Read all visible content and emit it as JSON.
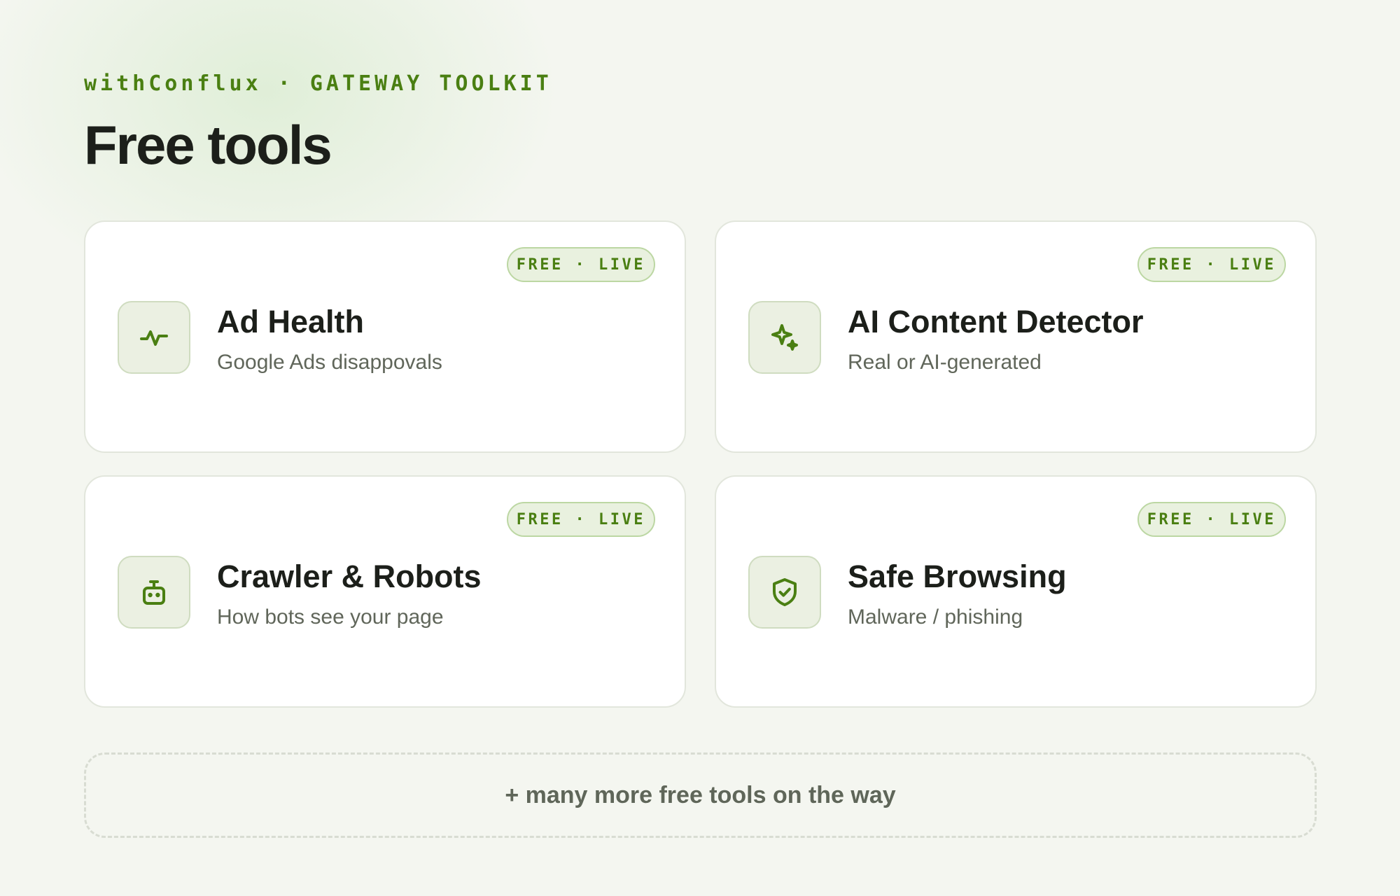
{
  "header": {
    "eyebrow": "withConflux · GATEWAY TOOLKIT",
    "title": "Free tools"
  },
  "tools": [
    {
      "name": "Ad Health",
      "description": "Google Ads disappovals",
      "badge": "FREE · LIVE",
      "icon": "activity-pulse-icon"
    },
    {
      "name": "AI Content Detector",
      "description": "Real or AI-generated",
      "badge": "FREE · LIVE",
      "icon": "sparkles-icon"
    },
    {
      "name": "Crawler & Robots",
      "description": "How bots see your page",
      "badge": "FREE · LIVE",
      "icon": "robot-icon"
    },
    {
      "name": "Safe Browsing",
      "description": "Malware / phishing",
      "badge": "FREE · LIVE",
      "icon": "shield-check-icon"
    }
  ],
  "footer": {
    "more_text": "+ many more free tools on the way"
  },
  "colors": {
    "accent": "#4a7f12",
    "background": "#f4f6f0",
    "card": "#ffffff",
    "badge_bg": "#e9f1df",
    "text": "#1c1f1a",
    "muted": "#60665a"
  }
}
